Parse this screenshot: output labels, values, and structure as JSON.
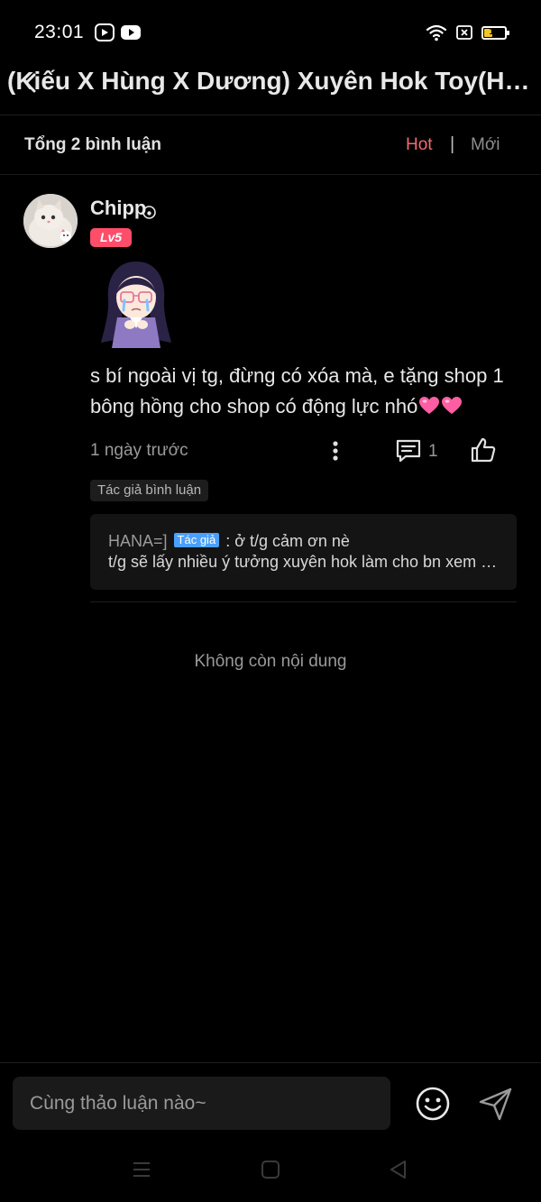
{
  "status_bar": {
    "time": "23:01",
    "icons": [
      "video-app-icon",
      "youtube-icon",
      "wifi-icon",
      "sim-icon",
      "battery-icon"
    ],
    "battery_level": "13",
    "battery_color": "#f3c623"
  },
  "header": {
    "title": "(Kiếu X Hùng X Dương) Xuyên Hok Toy(Hùng X Dương)",
    "back_icon": "chevron-left-icon"
  },
  "sort": {
    "total_label": "Tổng 2 bình luận",
    "hot_label": "Hot",
    "separator": "|",
    "new_label": "Mới",
    "active": "Hot",
    "active_color": "#f36a74"
  },
  "comment": {
    "username": "Chipp",
    "level": "Lv5",
    "level_color": "#ff4d6a",
    "text": "s bí ngoài vị tg, đừng có xóa mà, e tặng shop 1 bông hồng cho shop có động lực nhó",
    "time_ago": "1 ngày trước",
    "reply_count": "1",
    "author_tag": "Tác giả bình luận",
    "reply": {
      "author": "HANA=]",
      "tag": "Tác giả",
      "tag_color": "#4aa0ff",
      "line1": ": ở t/g cảm ơn nè",
      "line2": "t/g sẽ lấy nhiều ý tưởng xuyên hok làm cho bn xem nhé"
    }
  },
  "no_more_label": "Không còn nội dung",
  "input": {
    "placeholder": "Cùng thảo luận nào~"
  },
  "nav": {
    "icons": [
      "menu-icon",
      "home-square-icon",
      "back-triangle-icon"
    ]
  }
}
